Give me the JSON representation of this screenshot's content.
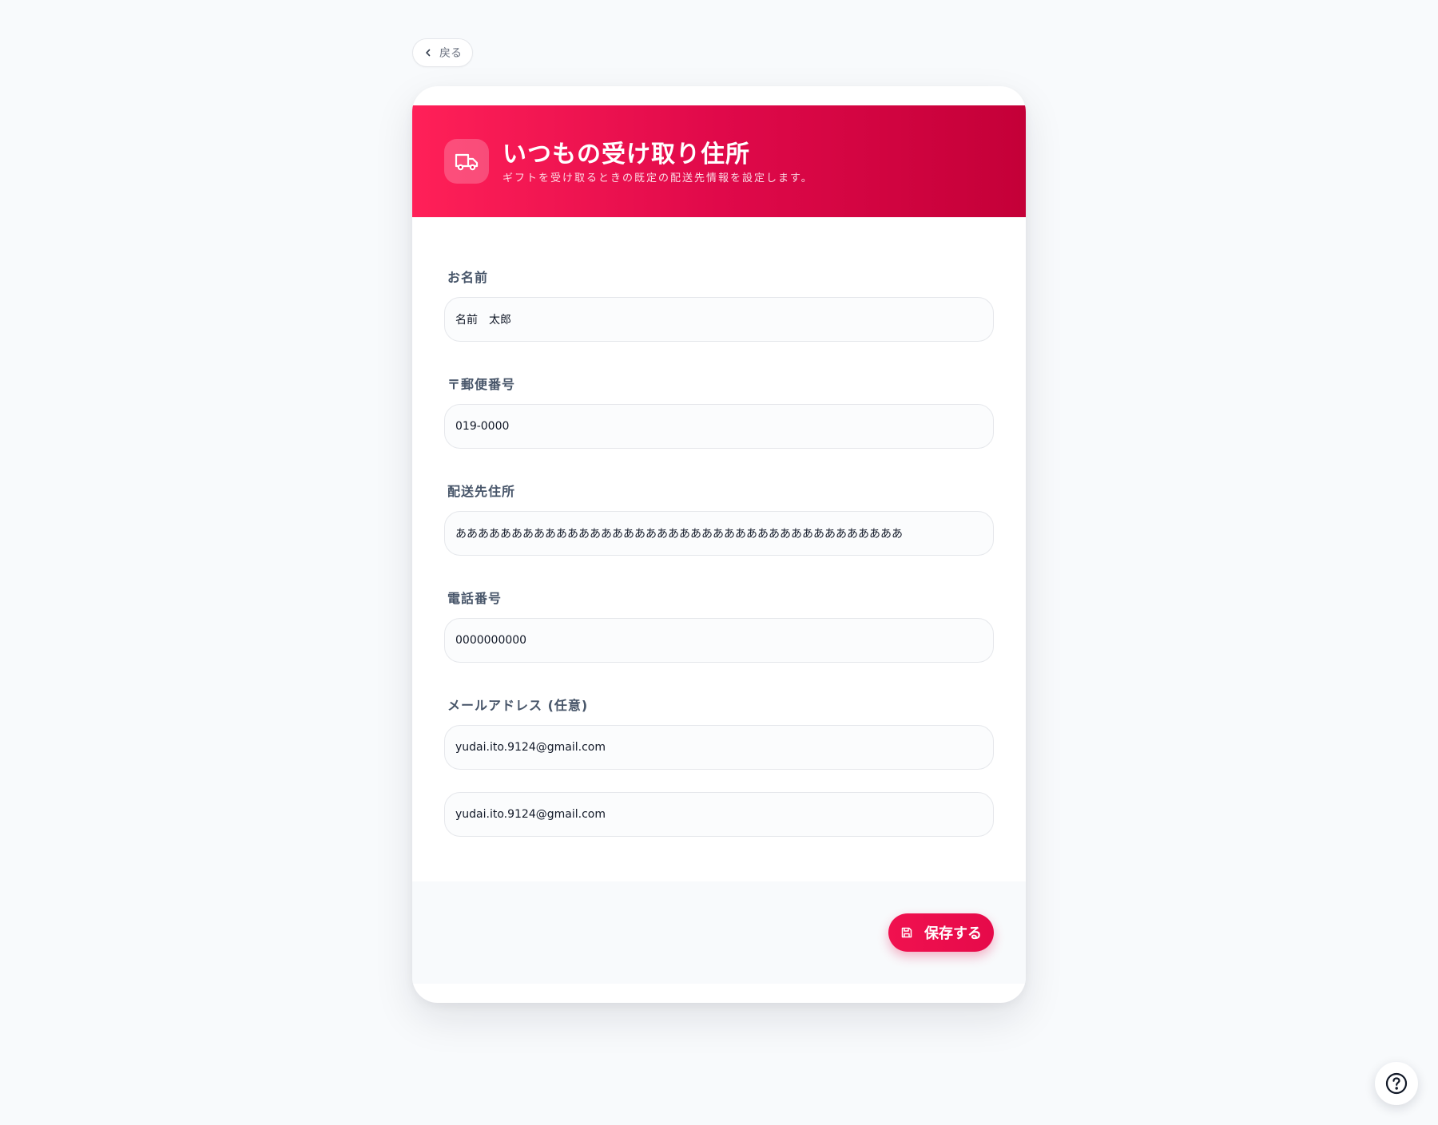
{
  "nav": {
    "back_label": "戻る"
  },
  "header": {
    "title": "いつもの受け取り住所",
    "subtitle": "ギフトを受け取るときの既定の配送先情報を設定します。",
    "icon": "truck-icon"
  },
  "form": {
    "name": {
      "label": "お名前",
      "value": "名前　太郎"
    },
    "postal": {
      "label": "〒郵便番号",
      "value": "019-0000"
    },
    "address": {
      "label": "配送先住所",
      "value": "ああああああああああああああああああああああああああああああああああああああああ"
    },
    "phone": {
      "label": "電話番号",
      "value": "0000000000"
    },
    "email": {
      "label": "メールアドレス (任意)",
      "value": "yudai.ito.9124@gmail.com",
      "confirm_value": "yudai.ito.9124@gmail.com"
    }
  },
  "footer": {
    "save_label": "保存する",
    "icon": "save-icon"
  },
  "help": {
    "icon": "help-icon"
  },
  "colors": {
    "accent": "#e60a4a",
    "accent_dark": "#c40038",
    "background": "#f8fafc"
  }
}
